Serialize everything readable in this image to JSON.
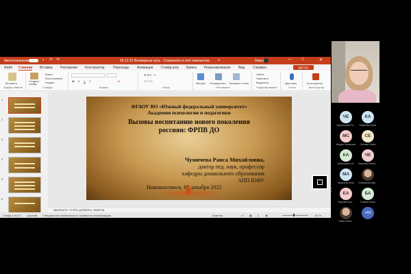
{
  "titlebar": {
    "autosave": "Автосохранение",
    "document": "09.12.22 Всемирные путь - Сохранено в этот компьютер ·",
    "user": "Raisa",
    "minimize": "—",
    "maximize": "□",
    "close": "✕"
  },
  "menu": {
    "tabs": [
      "Файл",
      "Главная",
      "Вставка",
      "Рисование",
      "Конструктор",
      "Переходы",
      "Анимация",
      "Слайд-шоу",
      "Запись",
      "Рецензирование",
      "Вид",
      "Справка"
    ],
    "share": "Доступ"
  },
  "ribbon": {
    "paste": "Вставить",
    "create_slide": "Создать слайд",
    "clipboard": "Буфер обмена",
    "slides": "Слайды",
    "font": "Шрифт",
    "paragraph": "Абзац",
    "drawing": "Рисование",
    "editing": "Редактирование",
    "voice": "Голос",
    "designer": "Конструктор",
    "dictate": "Диктовка",
    "figures": "Фигуры",
    "arrange": "Упорядочить",
    "styles": "Экспресс-стили",
    "find": "Найти",
    "replace": "Заменить",
    "select": "Выделить",
    "layout": "Макет",
    "reset": "Восстановить",
    "section": "Раздел",
    "designer_ideas": "Конструктор"
  },
  "slide": {
    "org_line1": "ФГАОУ ВО «Южный федеральный университет»",
    "org_line2": "Академия психологии и педагогики",
    "title_line1": "Вызовы воспитанию нового поколения",
    "title_line2": "россиян: ФРПВ ДО",
    "author": "Чумичева Раиса Михайловна,",
    "degree": "доктор пед. наук, профессор",
    "dept": "кафедры дошкольного образования",
    "inst": "АПП ЮФУ",
    "place_date": "Новошахтинск, 09 декабря 2022"
  },
  "thumbnails": [
    {
      "num": "1",
      "selected": true
    },
    {
      "num": "2",
      "selected": false
    },
    {
      "num": "3",
      "selected": false
    },
    {
      "num": "4",
      "selected": false
    },
    {
      "num": "5",
      "selected": false
    },
    {
      "num": "6",
      "selected": false
    }
  ],
  "notes": {
    "placeholder": "Щелкните, чтобы добавить заметки"
  },
  "status": {
    "slide_info": "Слайд 1 из 14",
    "language": "русский",
    "accessibility": "Специальные возможности: проверьте рекомендации",
    "notes": "Заметки",
    "zoom": "61 %"
  },
  "participants": [
    {
      "initials": "ЧЕ",
      "name": "Чернышова Ел...",
      "color": "#cfe3f0"
    },
    {
      "initials": "КА",
      "name": "Кавалёва Анна",
      "color": "#cfe3f0"
    },
    {
      "initials": "МС",
      "name": "Мария Семенова",
      "color": "#f4cccc"
    },
    {
      "initials": "СЕ",
      "name": "Сотова Елена",
      "color": "#f4e4c8"
    },
    {
      "initials": "КА",
      "name": "Кузнецова А.А.",
      "color": "#d4ecd4"
    },
    {
      "initials": "ЧЕ",
      "name": "Чернова Елена...",
      "color": "#f4cccc"
    },
    {
      "initials": "МА",
      "name": "Маркина Анна",
      "color": "#cfe3f0"
    },
    {
      "initials": "",
      "name": "Бобинская Вар...",
      "color": "photo"
    },
    {
      "initials": "ЕА",
      "name": "Ершова Ани...",
      "color": "#f4cccc"
    },
    {
      "initials": "БА",
      "name": "Бобина Анна",
      "color": "#d4ecd4"
    },
    {
      "initials": "",
      "name": "Новик Нина...",
      "color": "photo"
    },
    {
      "initials": "+60",
      "name": "",
      "color": "more"
    }
  ]
}
